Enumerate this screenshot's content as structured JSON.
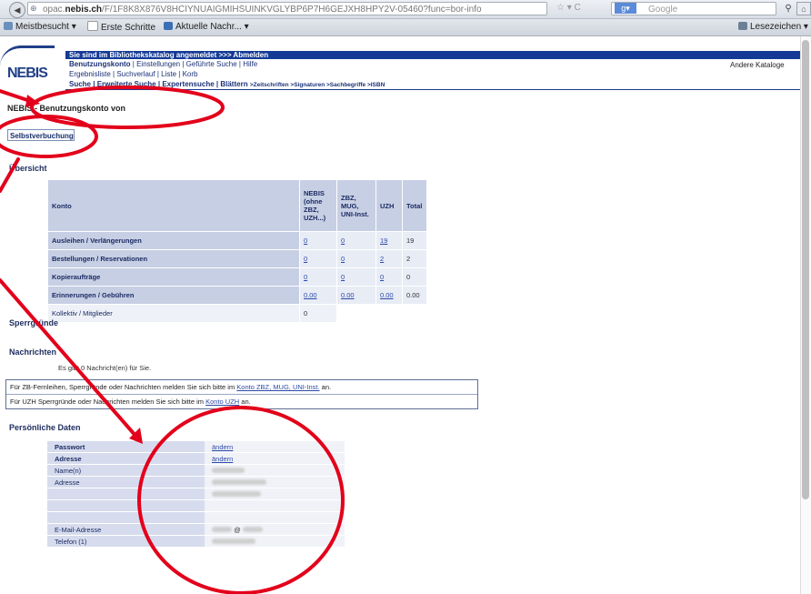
{
  "browser": {
    "url_prefix": "opac.",
    "url_host": "nebis.ch",
    "url_path": "/F/1F8K8X876V8HCIYNUAIGMIHSUINKVGLYBP6P7H6GEJXH8HPY2V-05460?func=bor-info",
    "search_engine": "Google",
    "bookmarks": [
      "Meistbesucht ▾",
      "Erste Schritte",
      "Aktuelle Nachr... ▾"
    ],
    "bookmarks_right": "Lesezeichen ▾"
  },
  "header": {
    "logo": "NEBIS",
    "banner": "Sie sind im Bibliothekskatalog angemeldet   >>> Abmelden",
    "nav_row1": [
      "Benutzungskonto",
      "Einstellungen",
      "Geführte Suche",
      "Hilfe"
    ],
    "nav_row2": [
      "Ergebnisliste",
      "Suchverlauf",
      "Liste",
      "Korb"
    ],
    "nav_row3": [
      "Suche",
      "Erweiterte Suche",
      "Expertensuche",
      "Blättern"
    ],
    "nav_row3_small": ">Zeitschriften >Signaturen >Sachbegriffe >ISBN",
    "other_catalogs": "Andere Kataloge"
  },
  "page": {
    "title": "NEBIS - Benutzungskonto von",
    "self_checkout": "Selbstverbuchung",
    "section_overview": "Übersicht",
    "section_block": "Sperrgründe",
    "section_messages": "Nachrichten",
    "messages_text": "Es gibt 0 Nachricht(en) für Sie.",
    "info_line1_pre": "Für ZB-Fernleihen, Sperrgründe oder Nachrichten melden Sie sich bitte im ",
    "info_line1_link": "Konto ZBZ, MUG, UNI-Inst.",
    "info_line1_post": " an.",
    "info_line2_pre": "Für UZH Sperrgründe oder Nachrichten melden Sie sich bitte im ",
    "info_line2_link": "Konto UZH",
    "info_line2_post": " an.",
    "section_personal": "Persönliche Daten"
  },
  "account_table": {
    "headers": [
      "Konto",
      "NEBIS (ohne ZBZ, UZH...)",
      "ZBZ, MUG, UNI-Inst.",
      "UZH",
      "Total"
    ],
    "rows": [
      {
        "label": "Ausleihen / Verlängerungen",
        "nebis": "0",
        "zbz": "0",
        "uzh": "19",
        "total": "19"
      },
      {
        "label": "Bestellungen / Reservationen",
        "nebis": "0",
        "zbz": "0",
        "uzh": "2",
        "total": "2"
      },
      {
        "label": "Kopieraufträge",
        "nebis": "0",
        "zbz": "0",
        "uzh": "0",
        "total": "0"
      },
      {
        "label": "Erinnerungen / Gebühren",
        "nebis": "0.00",
        "zbz": "0.00",
        "uzh": "0.00",
        "total": "0.00"
      }
    ],
    "collective_label": "Kollektiv / Mitglieder",
    "collective_value": "0"
  },
  "personal_data": {
    "rows": [
      {
        "key": "Passwort",
        "value": "ändern",
        "link": true,
        "bold": true
      },
      {
        "key": "Adresse",
        "value": "ändern",
        "link": true,
        "bold": true
      },
      {
        "key": "Name(n)",
        "value": "",
        "link": false,
        "bold": false
      },
      {
        "key": "Adresse",
        "value": "",
        "link": false,
        "bold": false
      },
      {
        "key": "",
        "value": "",
        "link": false,
        "bold": false
      },
      {
        "key": "",
        "value": "",
        "link": false,
        "bold": false
      },
      {
        "key": "",
        "value": "",
        "link": false,
        "bold": false
      },
      {
        "key": "E-Mail-Adresse",
        "value": "@",
        "link": false,
        "bold": false
      },
      {
        "key": "Telefon (1)",
        "value": "",
        "link": false,
        "bold": false
      }
    ]
  },
  "annotation_color": "#e3001b"
}
